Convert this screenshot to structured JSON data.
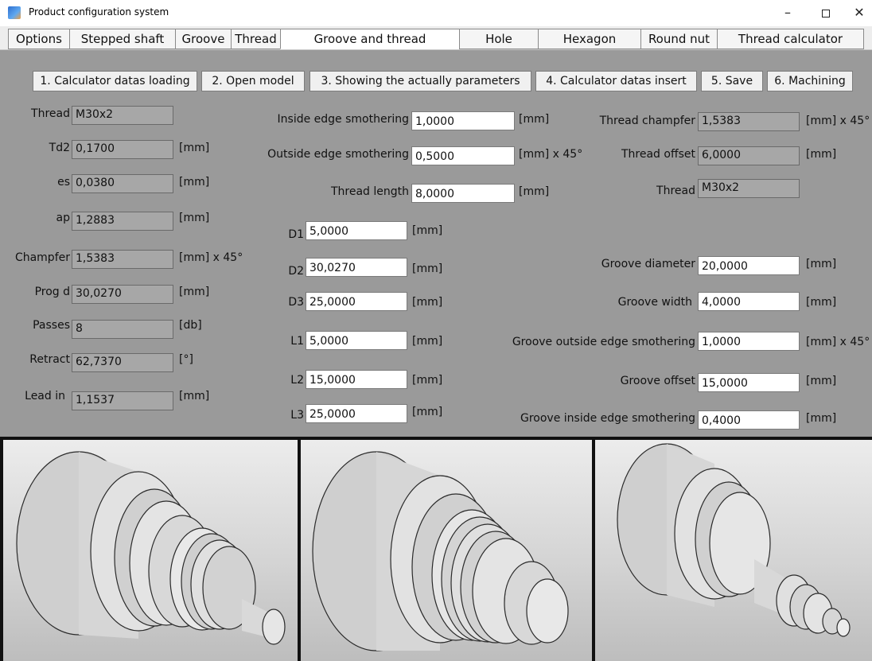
{
  "window": {
    "title": "Product configuration system"
  },
  "tabs": [
    {
      "label": "Options"
    },
    {
      "label": "Stepped shaft"
    },
    {
      "label": "Groove"
    },
    {
      "label": "Thread"
    },
    {
      "label": "Groove and thread"
    },
    {
      "label": "Hole"
    },
    {
      "label": "Hexagon"
    },
    {
      "label": "Round nut"
    },
    {
      "label": "Thread calculator"
    }
  ],
  "actions": [
    {
      "label": "1. Calculator datas loading"
    },
    {
      "label": "2. Open model"
    },
    {
      "label": "3. Showing the actually parameters"
    },
    {
      "label": "4. Calculator datas insert"
    },
    {
      "label": "5. Save"
    },
    {
      "label": "6. Machining"
    }
  ],
  "calc": {
    "thread": {
      "label": "Thread",
      "value": "M30x2"
    },
    "td2": {
      "label": "Td2",
      "value": "0,1700",
      "unit": "[mm]"
    },
    "es": {
      "label": "es",
      "value": "0,0380",
      "unit": "[mm]"
    },
    "ap": {
      "label": "ap",
      "value": "1,2883",
      "unit": "[mm]"
    },
    "champfer": {
      "label": "Champfer",
      "value": "1,5383",
      "unit": "[mm] x 45°"
    },
    "prog_d": {
      "label": "Prog d",
      "value": "30,0270",
      "unit": "[mm]"
    },
    "passes": {
      "label": "Passes",
      "value": "8",
      "unit": "[db]"
    },
    "retract": {
      "label": "Retract",
      "value": "62,7370",
      "unit": "[°]"
    },
    "lead_in": {
      "label": "Lead in",
      "value": "1,1537",
      "unit": "[mm]"
    }
  },
  "middle": {
    "inside_edge": {
      "label": "Inside edge smothering",
      "value": "1,0000",
      "unit": "[mm]"
    },
    "outside_edge": {
      "label": "Outside edge smothering",
      "value": "0,5000",
      "unit": "[mm] x 45°"
    },
    "thread_length": {
      "label": "Thread length",
      "value": "8,0000",
      "unit": "[mm]"
    },
    "d1": {
      "label": "D1",
      "value": "5,0000",
      "unit": "[mm]"
    },
    "d2": {
      "label": "D2",
      "value": "30,0270",
      "unit": "[mm]"
    },
    "d3": {
      "label": "D3",
      "value": "25,0000",
      "unit": "[mm]"
    },
    "l1": {
      "label": "L1",
      "value": "5,0000",
      "unit": "[mm]"
    },
    "l2": {
      "label": "L2",
      "value": "15,0000",
      "unit": "[mm]"
    },
    "l3": {
      "label": "L3",
      "value": "25,0000",
      "unit": "[mm]"
    }
  },
  "right": {
    "thread_champfer": {
      "label": "Thread champfer",
      "value": "1,5383",
      "unit": "[mm] x 45°"
    },
    "thread_offset": {
      "label": "Thread offset",
      "value": "6,0000",
      "unit": "[mm]"
    },
    "thread": {
      "label": "Thread",
      "value": "M30x2"
    },
    "groove_diameter": {
      "label": "Groove diameter",
      "value": "20,0000",
      "unit": "[mm]"
    },
    "groove_width": {
      "label": "Groove width",
      "value": "4,0000",
      "unit": "[mm]"
    },
    "groove_outside_edge": {
      "label": "Groove outside edge smothering",
      "value": "1,0000",
      "unit": "[mm] x 45°"
    },
    "groove_offset": {
      "label": "Groove offset",
      "value": "15,0000",
      "unit": "[mm]"
    },
    "groove_inside_edge": {
      "label": "Groove inside edge smothering",
      "value": "0,4000",
      "unit": "[mm]"
    }
  },
  "colors": {
    "background": "#9a9a9a",
    "readonly_field": "#a7a7a7",
    "editable_field": "#ffffff"
  }
}
